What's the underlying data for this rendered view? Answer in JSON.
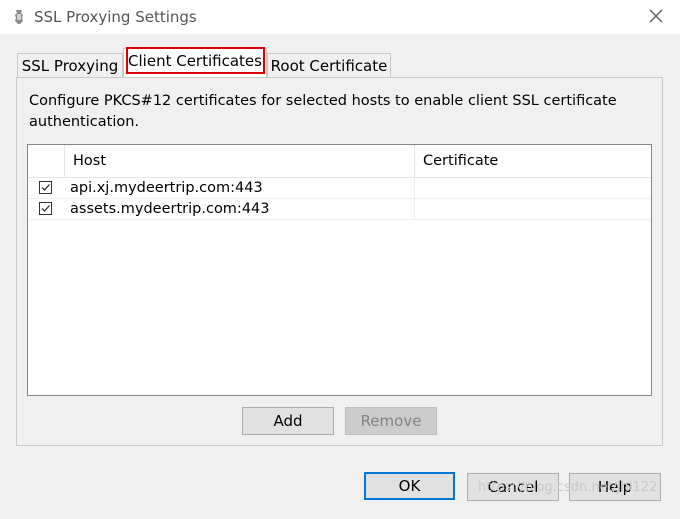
{
  "window": {
    "title": "SSL Proxying Settings",
    "close_glyph": "×"
  },
  "tabs": [
    {
      "label": "SSL Proxying",
      "active": false
    },
    {
      "label": "Client Certificates",
      "active": true
    },
    {
      "label": "Root Certificate",
      "active": false
    }
  ],
  "panel": {
    "description": "Configure PKCS#12 certificates for selected hosts to enable client SSL certificate authentication.",
    "table": {
      "columns": [
        "Host",
        "Certificate"
      ],
      "rows": [
        {
          "checked": true,
          "host": "api.xj.mydeertrip.com:443",
          "certificate": ""
        },
        {
          "checked": true,
          "host": "assets.mydeertrip.com:443",
          "certificate": ""
        }
      ]
    },
    "add_label": "Add",
    "remove_label": "Remove"
  },
  "footer": {
    "ok_label": "OK",
    "cancel_label": "Cancel",
    "help_label": "Help"
  },
  "watermark": "https://blog.csdn.net/jhl122",
  "colors": {
    "highlight": "#d80000",
    "default_button_border": "#0078d7",
    "client_bg": "#f0f0f0"
  },
  "icons": {
    "app": "charles-app-icon",
    "close": "close-icon",
    "check": "checkmark-icon"
  }
}
